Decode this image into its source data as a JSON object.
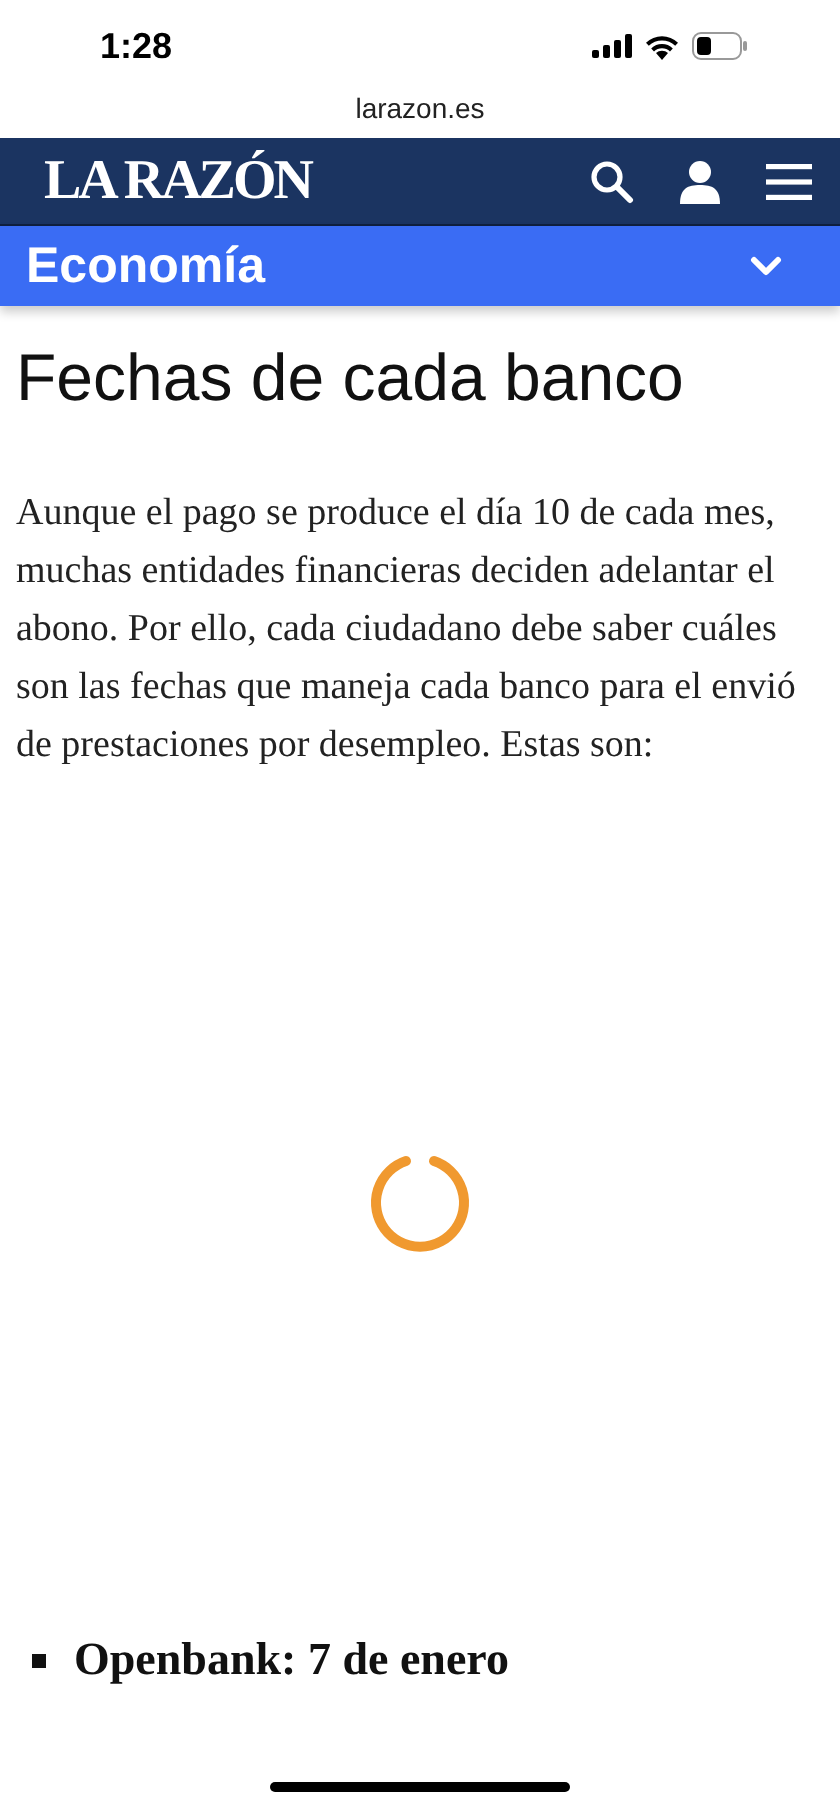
{
  "status_bar": {
    "time": "1:28"
  },
  "browser": {
    "url": "larazon.es"
  },
  "header": {
    "logo": "LA RAZÓN"
  },
  "section_bar": {
    "title": "Economía",
    "expanded": false
  },
  "article": {
    "heading": "Fechas de cada banco",
    "paragraph": "Aunque el pago se produce el día 10 de cada mes, muchas entidades financieras deciden adelantar el abono. Por ello, cada ciudadano debe saber cuáles son las fechas que maneja cada banco para el envió de prestaciones por desempleo. Estas son:",
    "loading": true,
    "list": [
      {
        "text": "Openbank: 7 de enero"
      }
    ]
  }
}
